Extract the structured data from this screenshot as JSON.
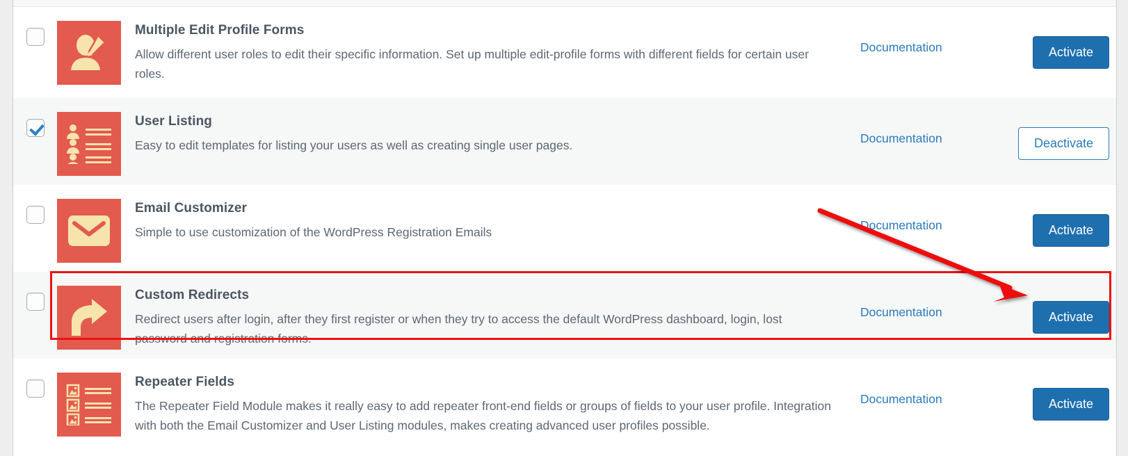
{
  "panel": {
    "documentation_label": "Documentation"
  },
  "modules": [
    {
      "checked": false,
      "icon": "user-edit-icon",
      "title": "Multiple Edit Profile Forms",
      "description": "Allow different user roles to edit their specific information. Set up multiple edit-profile forms with different fields for certain user roles.",
      "doc_label": "Documentation",
      "action_label": "Activate",
      "action_style": "primary"
    },
    {
      "checked": true,
      "icon": "user-listing-icon",
      "title": "User Listing",
      "description": "Easy to edit templates for listing your users as well as creating single user pages.",
      "doc_label": "Documentation",
      "action_label": "Deactivate",
      "action_style": "secondary"
    },
    {
      "checked": false,
      "icon": "envelope-icon",
      "title": "Email Customizer",
      "description": "Simple to use customization of the WordPress Registration Emails",
      "doc_label": "Documentation",
      "action_label": "Activate",
      "action_style": "primary"
    },
    {
      "checked": false,
      "icon": "redirect-arrow-icon",
      "title": "Custom Redirects",
      "description": "Redirect users after login, after they first register or when they try to access the default WordPress dashboard, login, lost password and registration forms.",
      "doc_label": "Documentation",
      "action_label": "Activate",
      "action_style": "primary"
    },
    {
      "checked": false,
      "icon": "repeater-fields-icon",
      "title": "Repeater Fields",
      "description": "The Repeater Field Module makes it really easy to add repeater front-end fields or groups of fields to your user profile. Integration with both the Email Customizer and User Listing modules, makes creating advanced user profiles possible.",
      "doc_label": "Documentation",
      "action_label": "Activate",
      "action_style": "primary"
    }
  ],
  "annotations": {
    "highlight_box": {
      "label": "custom-redirects-highlight",
      "color": "#ee1111"
    },
    "arrow": {
      "label": "pointer-arrow-to-activate",
      "color": "#ee1111"
    }
  },
  "colors": {
    "icon_background": "#e35a4e",
    "icon_glyph": "#f7e3ac",
    "primary_button": "#1e6fae",
    "link": "#2b7bbd",
    "annotation": "#ee1111",
    "row_alt": "#f6f7f7"
  }
}
